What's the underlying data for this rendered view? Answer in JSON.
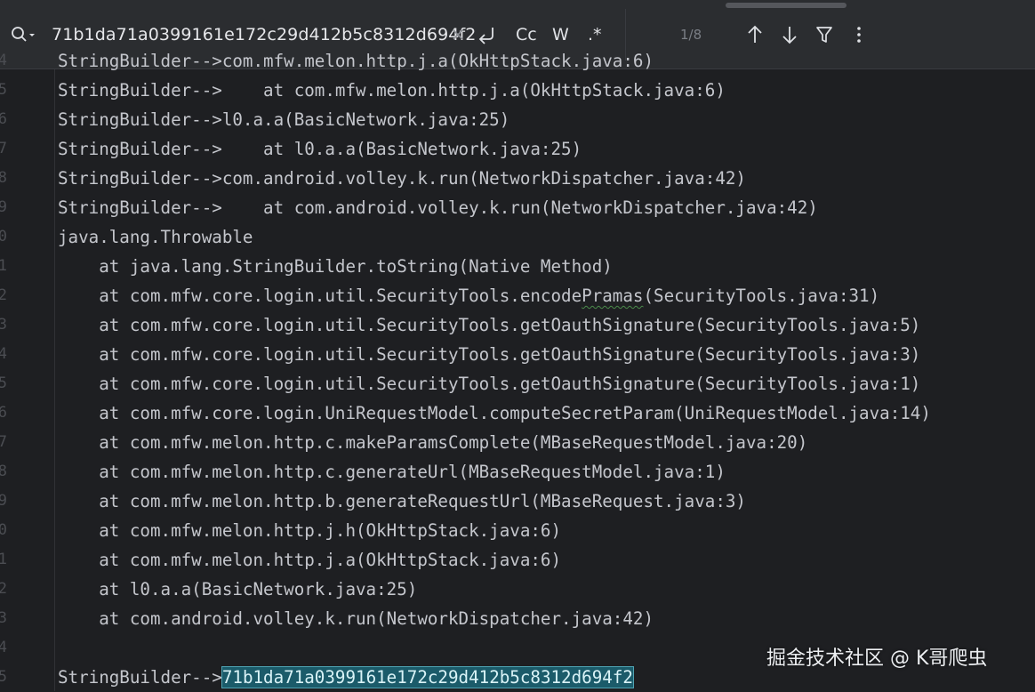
{
  "search": {
    "query": "71b1da71a0399161e172c29d412b5c8312d694f2",
    "match_case_label": "Cc",
    "words_label": "W",
    "regex_label": ".*",
    "match_count": "1/8"
  },
  "editor": {
    "lines": [
      {
        "num": "4",
        "pre": "StringBuilder-->com.mfw.melon.http.j.a(OkHttpStack.java:6)",
        "spell": "",
        "post": ""
      },
      {
        "num": "5",
        "pre": "StringBuilder-->    at com.mfw.melon.http.j.a(OkHttpStack.java:6)",
        "spell": "",
        "post": ""
      },
      {
        "num": "6",
        "pre": "StringBuilder-->l0.a.a(BasicNetwork.java:25)",
        "spell": "",
        "post": ""
      },
      {
        "num": "7",
        "pre": "StringBuilder-->    at l0.a.a(BasicNetwork.java:25)",
        "spell": "",
        "post": ""
      },
      {
        "num": "8",
        "pre": "StringBuilder-->com.android.volley.k.run(NetworkDispatcher.java:42)",
        "spell": "",
        "post": ""
      },
      {
        "num": "9",
        "pre": "StringBuilder-->    at com.android.volley.k.run(NetworkDispatcher.java:42)",
        "spell": "",
        "post": ""
      },
      {
        "num": "0",
        "pre": "java.lang.Throwable",
        "spell": "",
        "post": ""
      },
      {
        "num": "1",
        "pre": "    at java.lang.StringBuilder.toString(Native Method)",
        "spell": "",
        "post": ""
      },
      {
        "num": "2",
        "pre": "    at com.mfw.core.login.util.SecurityTools.encode",
        "spell": "Pramas",
        "post": "(SecurityTools.java:31)"
      },
      {
        "num": "3",
        "pre": "    at com.mfw.core.login.util.SecurityTools.getOauthSignature(SecurityTools.java:5)",
        "spell": "",
        "post": ""
      },
      {
        "num": "4",
        "pre": "    at com.mfw.core.login.util.SecurityTools.getOauthSignature(SecurityTools.java:3)",
        "spell": "",
        "post": ""
      },
      {
        "num": "5",
        "pre": "    at com.mfw.core.login.util.SecurityTools.getOauthSignature(SecurityTools.java:1)",
        "spell": "",
        "post": ""
      },
      {
        "num": "6",
        "pre": "    at com.mfw.core.login.UniRequestModel.computeSecretParam(UniRequestModel.java:14)",
        "spell": "",
        "post": ""
      },
      {
        "num": "7",
        "pre": "    at com.mfw.melon.http.c.makeParamsComplete(MBaseRequestModel.java:20)",
        "spell": "",
        "post": ""
      },
      {
        "num": "8",
        "pre": "    at com.mfw.melon.http.c.generateUrl(MBaseRequestModel.java:1)",
        "spell": "",
        "post": ""
      },
      {
        "num": "9",
        "pre": "    at com.mfw.melon.http.b.generateRequestUrl(MBaseRequest.java:3)",
        "spell": "",
        "post": ""
      },
      {
        "num": "0",
        "pre": "    at com.mfw.melon.http.j.h(OkHttpStack.java:6)",
        "spell": "",
        "post": ""
      },
      {
        "num": "1",
        "pre": "    at com.mfw.melon.http.j.a(OkHttpStack.java:6)",
        "spell": "",
        "post": ""
      },
      {
        "num": "2",
        "pre": "    at l0.a.a(BasicNetwork.java:25)",
        "spell": "",
        "post": ""
      },
      {
        "num": "3",
        "pre": "    at com.android.volley.k.run(NetworkDispatcher.java:42)",
        "spell": "",
        "post": ""
      },
      {
        "num": "4",
        "pre": "",
        "spell": "",
        "post": ""
      }
    ],
    "last_line": {
      "num": "5",
      "prefix": "StringBuilder-->",
      "match": "71b1da71a0399161e172c29d412b5c8312d694f2"
    }
  },
  "watermark": "掘金技术社区 @ K哥爬虫",
  "colors": {
    "background": "#1e1f22",
    "toolbar": "#2b2d30",
    "match_highlight": "#1b5b6a",
    "text": "#bcbec4"
  },
  "icons": [
    "search-icon",
    "clear-icon",
    "newline-icon",
    "arrow-up-icon",
    "arrow-down-icon",
    "filter-icon",
    "more-icon"
  ]
}
